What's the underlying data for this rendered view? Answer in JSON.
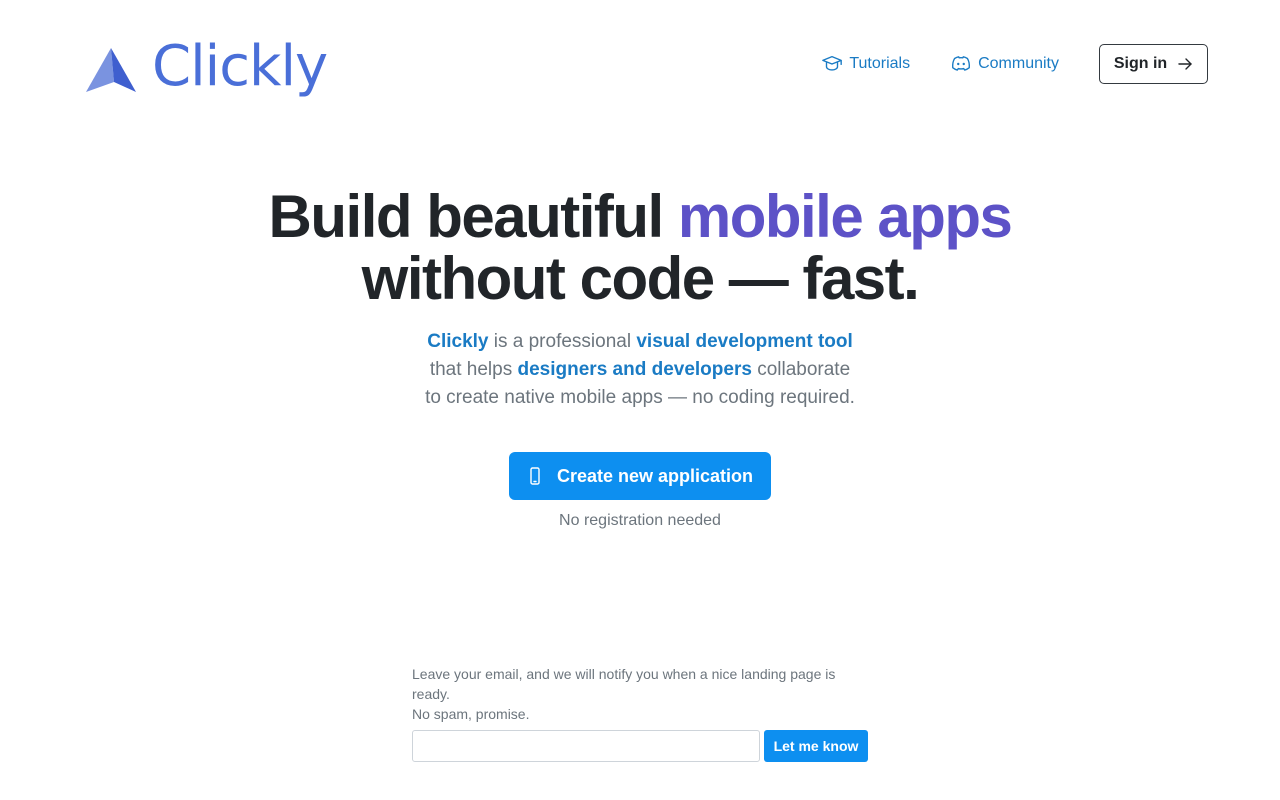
{
  "header": {
    "logo_text": "Clickly",
    "nav": {
      "tutorials_label": "Tutorials",
      "tutorials_icon": "graduation-cap-icon",
      "community_label": "Community",
      "community_icon": "discord-icon",
      "signin_label": "Sign in",
      "signin_icon": "arrow-right-icon"
    }
  },
  "hero": {
    "title_part1": "Build beautiful ",
    "title_accent": "mobile apps",
    "title_part2": "without code — fast.",
    "sub": {
      "brand": "Clickly",
      "t1": " is a professional ",
      "hl1": "visual development tool",
      "t2": "that helps ",
      "hl2": "designers and developers",
      "t3": " collaborate",
      "t4": "to create native mobile apps — no coding required."
    },
    "cta_label": "Create new application",
    "cta_icon": "mobile-phone-icon",
    "cta_note": "No registration needed"
  },
  "notify": {
    "line1": "Leave your email, and we will notify you when a nice landing page is ready.",
    "line2": "No spam, promise.",
    "email_value": "",
    "email_placeholder": "",
    "button_label": "Let me know"
  },
  "colors": {
    "brand": "#4a6fd8",
    "accent_purple": "#5d52c7",
    "link_blue": "#1a7bc4",
    "primary_button": "#0d8ff0",
    "muted_text": "#6c757d",
    "heading": "#212529"
  }
}
